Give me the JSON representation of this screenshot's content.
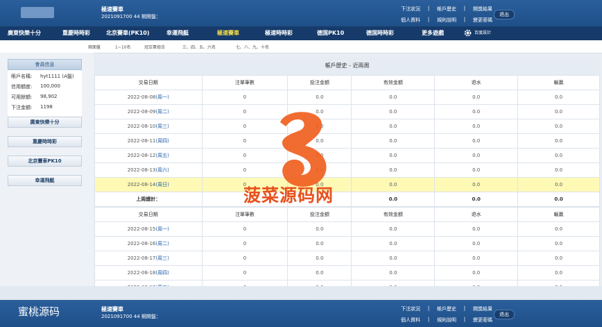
{
  "header": {
    "game_name": "極速賽車",
    "period_info": "2021091700 44 期開盤：",
    "links_row1": [
      "下注狀況",
      "|",
      "帳戶歷史",
      "|",
      "開獎結果"
    ],
    "links_row2": [
      "個人資料",
      "|",
      "規則說明",
      "|",
      "變更密碼"
    ],
    "logout_label": "退出"
  },
  "nav": {
    "items": [
      "廣東快樂十分",
      "重慶時時彩",
      "北京賽車(PK10)",
      "幸運飛艇",
      "極速賽車",
      "極速時時彩",
      "德国PK10",
      "德国時時彩",
      "更多遊戲",
      "百度設計"
    ],
    "active_index": 4
  },
  "subbar": {
    "items": [
      "兩面盤",
      "1~10名",
      "冠亞軍組合",
      "三、四、五、六名",
      "七、八、九、十名"
    ]
  },
  "member": {
    "title": "會員信息",
    "rows": [
      {
        "k": "賬戶名稱:",
        "v": "hyt1111 (A盤)"
      },
      {
        "k": "信用額度:",
        "v": "100,000"
      },
      {
        "k": "可用餘額:",
        "v": "98,902"
      },
      {
        "k": "下注金額:",
        "v": "1198"
      }
    ]
  },
  "side_buttons": [
    "廣東快樂十分",
    "重慶時時彩",
    "北京賽車PK10",
    "幸運飛艇"
  ],
  "history": {
    "title": "帳戶歷史 - 近兩周",
    "headers": [
      "交易日期",
      "注單筆數",
      "投注金額",
      "有效金額",
      "退水",
      "輸贏"
    ],
    "week1": [
      {
        "date": "2022-08-08",
        "wd": "(周一)",
        "n": "0",
        "a": "0.0",
        "b": "0.0",
        "c": "0.0",
        "d": "0.0"
      },
      {
        "date": "2022-08-09",
        "wd": "(周二)",
        "n": "0",
        "a": "0.0",
        "b": "0.0",
        "c": "0.0",
        "d": "0.0"
      },
      {
        "date": "2022-08-10",
        "wd": "(周三)",
        "n": "0",
        "a": "0.0",
        "b": "0.0",
        "c": "0.0",
        "d": "0.0"
      },
      {
        "date": "2022-08-11",
        "wd": "(周四)",
        "n": "0",
        "a": "0.0",
        "b": "0.0",
        "c": "0.0",
        "d": "0.0"
      },
      {
        "date": "2022-08-12",
        "wd": "(周五)",
        "n": "0",
        "a": "0.0",
        "b": "0.0",
        "c": "0.0",
        "d": "0.0"
      },
      {
        "date": "2022-08-13",
        "wd": "(周六)",
        "n": "0",
        "a": "0.0",
        "b": "0.0",
        "c": "0.0",
        "d": "0.0"
      },
      {
        "date": "2022-08-14",
        "wd": "(周日)",
        "n": "0",
        "a": "0.0",
        "b": "0.0",
        "c": "0.0",
        "d": "0.0"
      }
    ],
    "week1_total": {
      "label": "上周總計：",
      "n": "",
      "a": "",
      "b": "0.0",
      "c": "0.0",
      "d": "0.0"
    },
    "week2": [
      {
        "date": "2022-08-15",
        "wd": "(周一)",
        "n": "0",
        "a": "0.0",
        "b": "0.0",
        "c": "0.0",
        "d": "0.0"
      },
      {
        "date": "2022-08-16",
        "wd": "(周二)",
        "n": "0",
        "a": "0.0",
        "b": "0.0",
        "c": "0.0",
        "d": "0.0"
      },
      {
        "date": "2022-08-17",
        "wd": "(周三)",
        "n": "0",
        "a": "0.0",
        "b": "0.0",
        "c": "0.0",
        "d": "0.0"
      },
      {
        "date": "2022-08-18",
        "wd": "(周四)",
        "n": "0",
        "a": "0.0",
        "b": "0.0",
        "c": "0.0",
        "d": "0.0"
      },
      {
        "date": "2022-08-19",
        "wd": "(周五)",
        "n": "0",
        "a": "0.0",
        "b": "0.0",
        "c": "0.0",
        "d": "0.0"
      }
    ]
  },
  "footer": {
    "brand": "蜜桃源码",
    "game_name": "極速賽車",
    "period_info": "2021091700 44 期開盤：",
    "links_row1": [
      "下注狀況",
      "|",
      "帳戶歷史",
      "|",
      "開獎結果"
    ],
    "links_row2": [
      "個人資料",
      "|",
      "規則說明",
      "|",
      "變更密碼"
    ],
    "logout_label": "退出"
  },
  "watermark": {
    "text": "菠菜源码网",
    "color": "#e8511d"
  }
}
